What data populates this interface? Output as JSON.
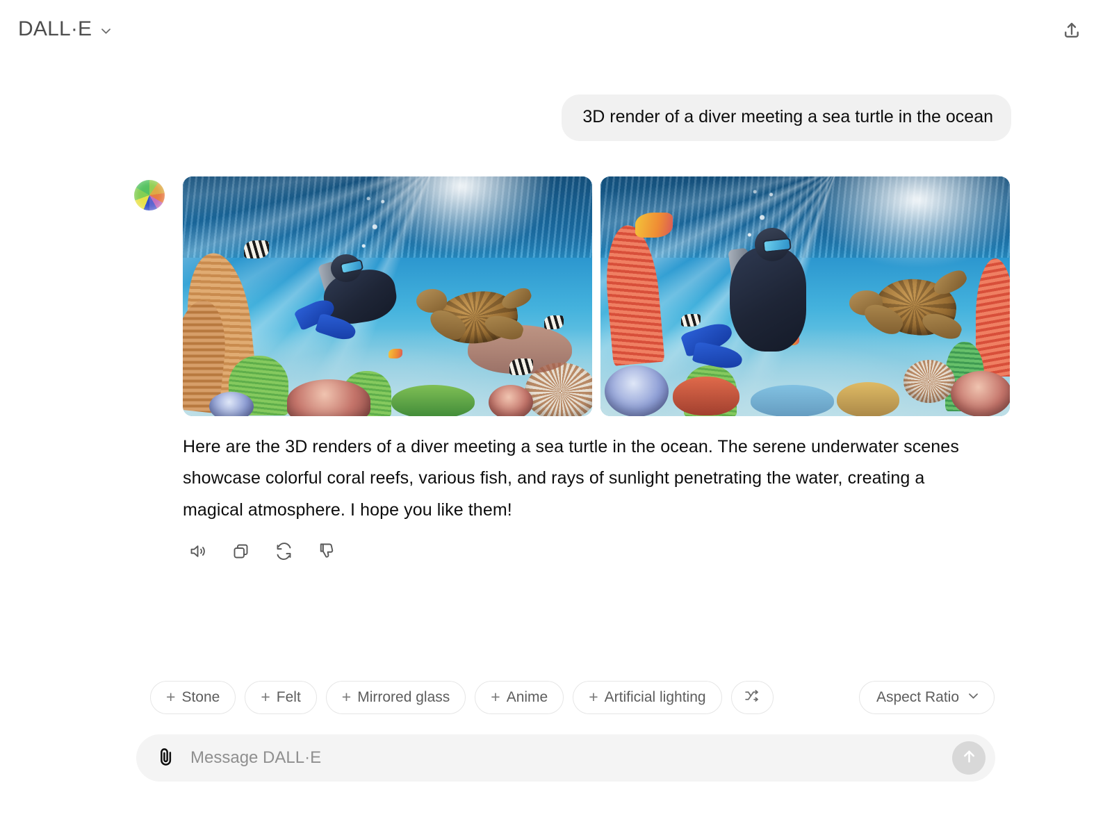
{
  "header": {
    "brand_title": "DALL·E",
    "brand_chevron_icon": "chevron-down-icon",
    "share_icon": "upload-share-icon"
  },
  "conversation": {
    "user_message": "3D render of a diver meeting a sea turtle in the ocean",
    "assistant": {
      "avatar_icon": "dalle-logo-icon",
      "images": [
        {
          "alt": "3D render of a scuba diver reaching toward a sea turtle above a colorful coral reef with sunbeams"
        },
        {
          "alt": "3D render of a scuba diver facing a sea turtle with sunrays piercing the water over a coral reef"
        }
      ],
      "text": "Here are the 3D renders of a diver meeting a sea turtle in the ocean. The serene underwater scenes showcase colorful coral reefs, various fish, and rays of sunlight penetrating the water, creating a magical atmosphere. I hope you like them!",
      "actions": [
        {
          "name": "read-aloud-button",
          "icon": "speaker-icon"
        },
        {
          "name": "copy-button",
          "icon": "copy-icon"
        },
        {
          "name": "regenerate-button",
          "icon": "refresh-icon"
        },
        {
          "name": "dislike-button",
          "icon": "thumbs-down-icon"
        }
      ]
    }
  },
  "suggestions": {
    "chips": [
      {
        "plus": "+",
        "label": "Stone"
      },
      {
        "plus": "+",
        "label": "Felt"
      },
      {
        "plus": "+",
        "label": "Mirrored glass"
      },
      {
        "plus": "+",
        "label": "Anime"
      },
      {
        "plus": "+",
        "label": "Artificial lighting"
      }
    ],
    "shuffle_icon": "shuffle-icon",
    "aspect_ratio_label": "Aspect Ratio",
    "aspect_ratio_chevron_icon": "chevron-down-icon"
  },
  "composer": {
    "attach_icon": "paperclip-icon",
    "placeholder": "Message DALL·E",
    "value": "",
    "send_icon": "arrow-up-icon"
  },
  "colors": {
    "page_background": "#ffffff",
    "user_bubble": "#f1f1f1",
    "composer_background": "#f4f4f4",
    "chip_border": "#e6e6e6",
    "text_primary": "#0d0d0d",
    "text_muted": "#5d5d5d",
    "send_button": "#d8d8d8"
  }
}
